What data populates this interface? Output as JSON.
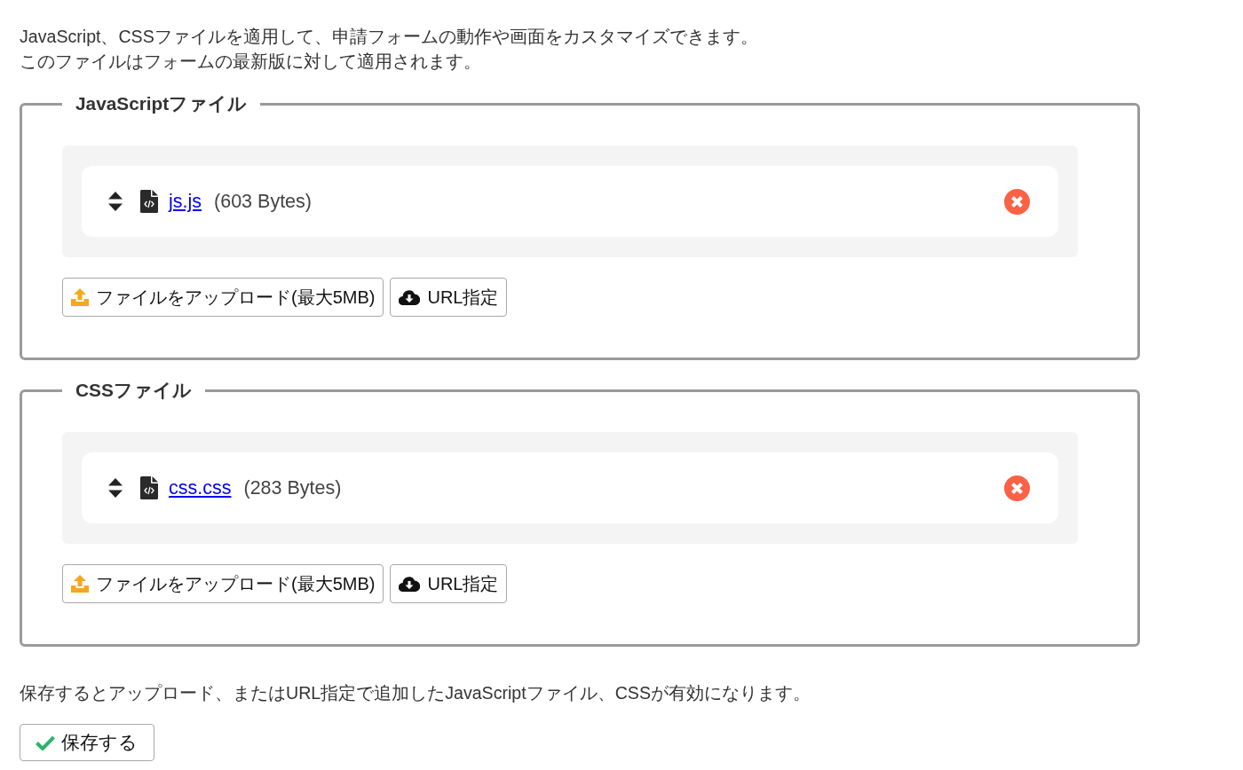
{
  "intro": [
    "JavaScript、CSSファイルを適用して、申請フォームの動作や画面をカスタマイズできます。",
    "このファイルはフォームの最新版に対して適用されます。"
  ],
  "sections": [
    {
      "legend": "JavaScriptファイル",
      "files": [
        {
          "name": "js.js",
          "size": "(603 Bytes)"
        }
      ],
      "buttons": [
        {
          "kind": "upload",
          "label": "ファイルをアップロード(最大5MB)"
        },
        {
          "kind": "url",
          "label": "URL指定"
        }
      ]
    },
    {
      "legend": "CSSファイル",
      "files": [
        {
          "name": "css.css",
          "size": "(283 Bytes)"
        }
      ],
      "buttons": [
        {
          "kind": "upload",
          "label": "ファイルをアップロード(最大5MB)"
        },
        {
          "kind": "url",
          "label": "URL指定"
        }
      ]
    }
  ],
  "note": "保存するとアップロード、またはURL指定で追加したJavaScriptファイル、CSSが有効になります。",
  "save_button": {
    "label": "保存する"
  }
}
